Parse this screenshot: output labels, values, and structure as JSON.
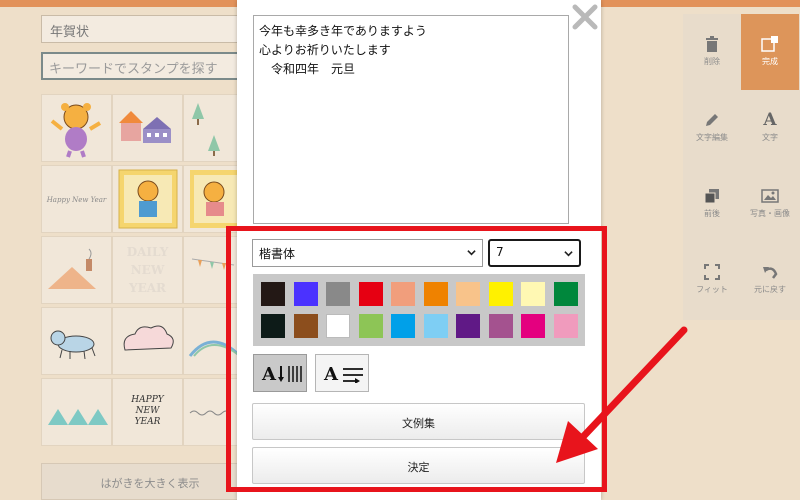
{
  "left_panel": {
    "category_select": "年賀状",
    "search_placeholder": "キーワードでスタンプを探す",
    "stamps": [
      "tiger-mascot",
      "houses",
      "tree",
      "happy-new-year-text",
      "tiger-frame",
      "tiger-frame-2",
      "house-roof",
      "daily-new-year",
      "flags",
      "tiger-walking",
      "cloud",
      "hill",
      "triangles",
      "happy-new-year-circle",
      "handwritten-text"
    ],
    "large_view_button": "はがきを大きく表示",
    "stamp_texts": {
      "happy_new_year": "Happy New Year",
      "daily": "DAILY",
      "new": "NEW",
      "year": "YEAR",
      "happy_circle_1": "HAPPY",
      "happy_circle_2": "NEW",
      "happy_circle_3": "YEAR"
    }
  },
  "toolbar": {
    "items": [
      {
        "label": "削除",
        "icon": "trash-icon"
      },
      {
        "label": "完成",
        "icon": "complete-icon"
      },
      {
        "label": "文字編集",
        "icon": "pencil-icon"
      },
      {
        "label": "文字",
        "icon": "text-A-icon"
      },
      {
        "label": "前後",
        "icon": "layers-icon"
      },
      {
        "label": "写真・画像",
        "icon": "image-icon"
      },
      {
        "label": "フィット",
        "icon": "fit-icon"
      },
      {
        "label": "元に戻す",
        "icon": "undo-icon"
      }
    ],
    "active_color": "#dd955a"
  },
  "modal": {
    "text_value": "今年も幸多き年でありますよう\n心よりお祈りいたします\n　令和四年　元旦",
    "font_select": "楷書体",
    "size_select": "7",
    "palette": [
      "#231815",
      "#4b32ff",
      "#898989",
      "#e60012",
      "#f19e7c",
      "#ef8200",
      "#f8c38a",
      "#fff100",
      "#fff8b3",
      "#00873c",
      "#0d1b18",
      "#8c4e1d",
      "#ffffff",
      "#8dc556",
      "#00a0e9",
      "#7ecef4",
      "#601986",
      "#a4528f",
      "#e4007f",
      "#f09bbd"
    ],
    "vertical_label": "A",
    "horizontal_label": "A",
    "examples_button": "文例集",
    "confirm_button": "決定"
  },
  "annotation": {
    "highlight_color": "#e8141c"
  }
}
